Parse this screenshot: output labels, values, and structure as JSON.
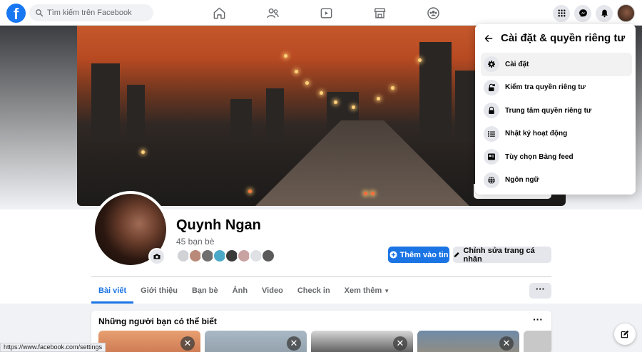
{
  "header": {
    "search_placeholder": "Tìm kiếm trên Facebook",
    "logo_letter": "f",
    "nav_icons": [
      "home-icon",
      "friends-icon",
      "watch-icon",
      "marketplace-icon",
      "groups-icon"
    ],
    "right_icons": [
      "menu-grid-icon",
      "messenger-icon",
      "notifications-icon",
      "account-avatar"
    ]
  },
  "profile": {
    "name": "Quynh Ngan",
    "friends_count": "45 bạn bè",
    "add_story_label": "Thêm vào tin",
    "edit_profile_label": "Chỉnh sửa trang cá nhân"
  },
  "tabs": [
    {
      "label": "Bài viết",
      "active": true
    },
    {
      "label": "Giới thiệu"
    },
    {
      "label": "Bạn bè"
    },
    {
      "label": "Ảnh"
    },
    {
      "label": "Video"
    },
    {
      "label": "Check in"
    },
    {
      "label": "Xem thêm"
    }
  ],
  "tabs_more_label": "···",
  "suggestions": {
    "title": "Những người bạn có thể biết",
    "more_label": "···",
    "close_label": "✕"
  },
  "dropdown": {
    "title": "Cài đặt & quyền riêng tư",
    "items": [
      {
        "label": "Cài đặt",
        "icon": "gear-icon"
      },
      {
        "label": "Kiểm tra quyền riêng tư",
        "icon": "lock-check-icon"
      },
      {
        "label": "Trung tâm quyền riêng tư",
        "icon": "lock-icon"
      },
      {
        "label": "Nhật ký hoạt động",
        "icon": "list-icon"
      },
      {
        "label": "Tùy chọn Bảng feed",
        "icon": "feed-icon"
      },
      {
        "label": "Ngôn ngữ",
        "icon": "globe-icon"
      }
    ]
  },
  "status_url": "https://www.facebook.com/settings",
  "colors": {
    "brand": "#1877f2",
    "primary_button": "#1b74e4",
    "secondary_button": "#e4e6eb"
  }
}
